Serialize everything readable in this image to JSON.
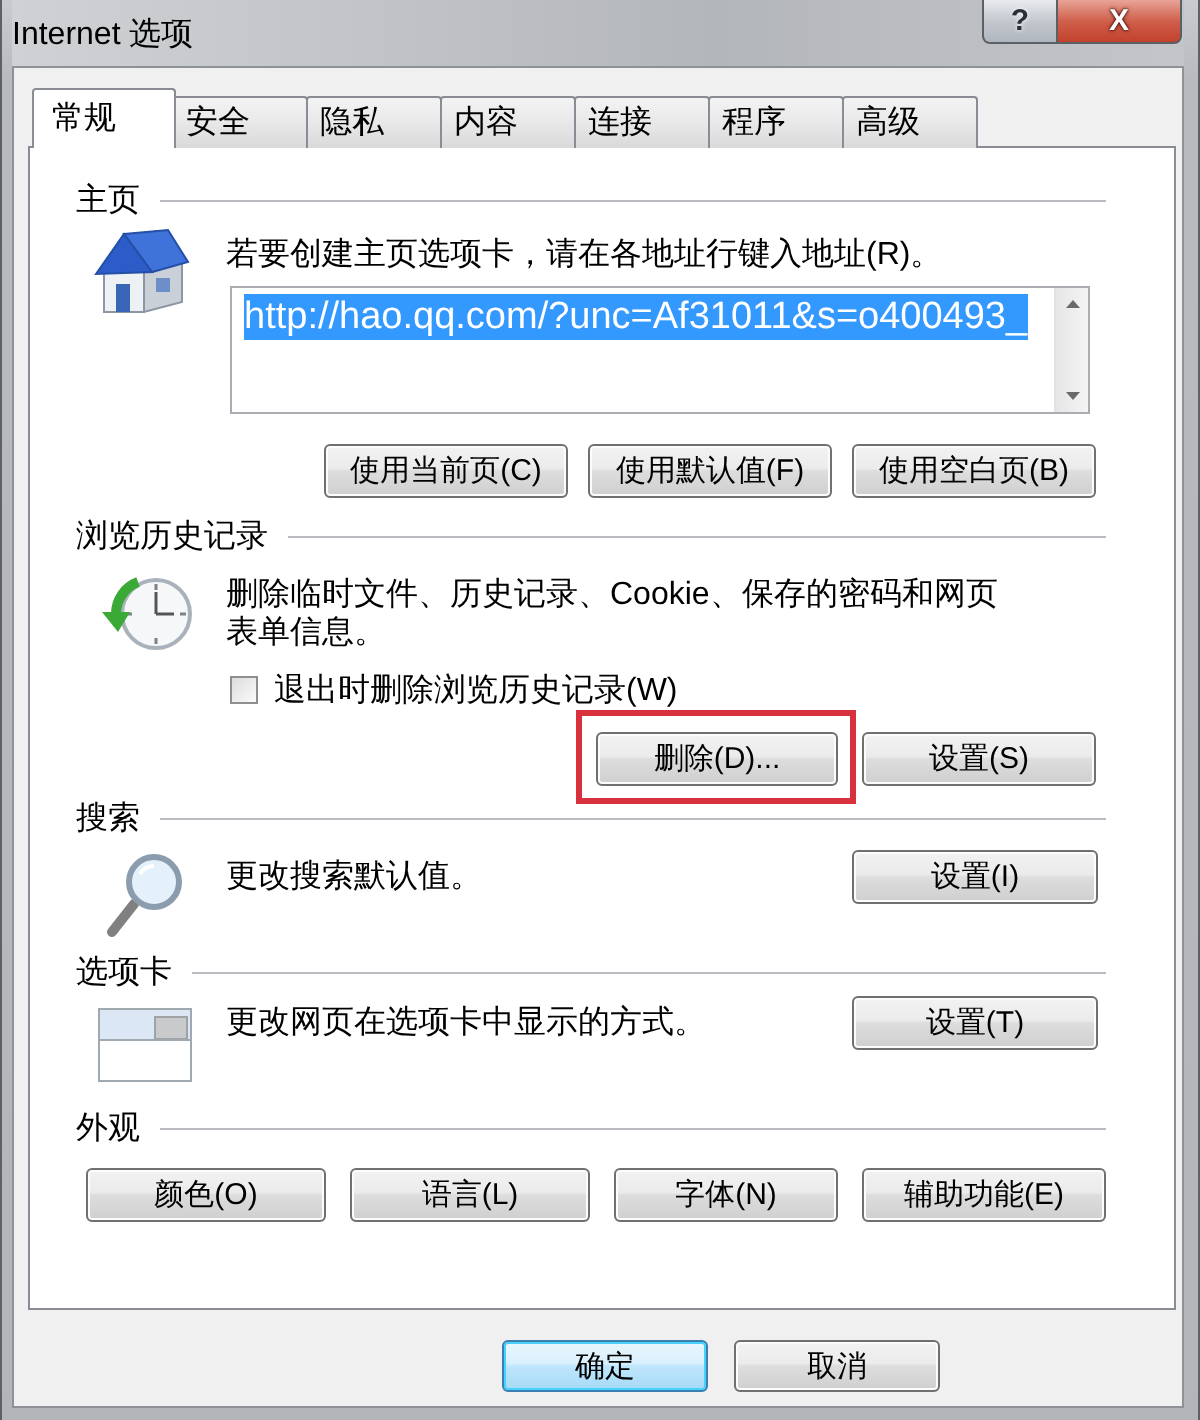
{
  "window": {
    "title": "Internet 选项",
    "caption_buttons": [
      {
        "kind": "help",
        "label": "?"
      },
      {
        "kind": "close",
        "label": "X"
      }
    ]
  },
  "tabs": [
    {
      "label": "常规",
      "selected": true
    },
    {
      "label": "安全",
      "selected": false
    },
    {
      "label": "隐私",
      "selected": false
    },
    {
      "label": "内容",
      "selected": false
    },
    {
      "label": "连接",
      "selected": false
    },
    {
      "label": "程序",
      "selected": false
    },
    {
      "label": "高级",
      "selected": false
    }
  ],
  "sections": [
    {
      "kind": "home",
      "title": "主页",
      "description": "若要创建主页选项卡，请在各地址行键入地址(R)。",
      "address": {
        "value": "http://hao.qq.com/?unc=Af31011&s=o400493_",
        "selected": true
      },
      "buttons": [
        {
          "label": "使用当前页(C)"
        },
        {
          "label": "使用默认值(F)"
        },
        {
          "label": "使用空白页(B)"
        }
      ]
    },
    {
      "kind": "history",
      "title": "浏览历史记录",
      "description": "删除临时文件、历史记录、Cookie、保存的密码和网页表单信息。",
      "checkbox": {
        "label": "退出时删除浏览历史记录(W)",
        "checked": false
      },
      "buttons": [
        {
          "label": "删除(D)...",
          "highlighted": true
        },
        {
          "label": "设置(S)",
          "highlighted": false
        }
      ]
    },
    {
      "kind": "search",
      "title": "搜索",
      "description": "更改搜索默认值。",
      "buttons": [
        {
          "label": "设置(I)"
        }
      ]
    },
    {
      "kind": "tabs",
      "title": "选项卡",
      "description": "更改网页在选项卡中显示的方式。",
      "buttons": [
        {
          "label": "设置(T)"
        }
      ]
    },
    {
      "kind": "appearance",
      "title": "外观",
      "buttons": [
        {
          "label": "颜色(O)"
        },
        {
          "label": "语言(L)"
        },
        {
          "label": "字体(N)"
        },
        {
          "label": "辅助功能(E)"
        }
      ]
    }
  ],
  "footer_buttons": [
    {
      "label": "确定",
      "default": true
    },
    {
      "label": "取消",
      "default": false
    }
  ]
}
